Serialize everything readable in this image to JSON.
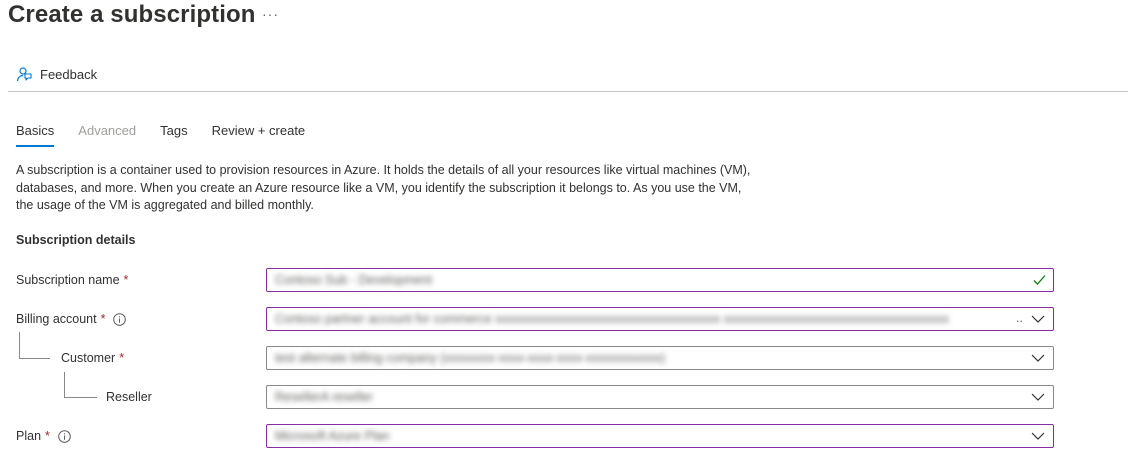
{
  "page": {
    "title": "Create a subscription",
    "more_label": "···"
  },
  "toolbar": {
    "feedback_label": "Feedback",
    "feedback_icon": "feedback-person-icon"
  },
  "tabs": [
    {
      "label": "Basics",
      "state": "active"
    },
    {
      "label": "Advanced",
      "state": "disabled"
    },
    {
      "label": "Tags",
      "state": "normal"
    },
    {
      "label": "Review + create",
      "state": "normal"
    }
  ],
  "description": "A subscription is a container used to provision resources in Azure. It holds the details of all your resources like virtual machines (VM), databases, and more. When you create an Azure resource like a VM, you identify the subscription it belongs to. As you use the VM, the usage of the VM is aggregated and billed monthly.",
  "section": {
    "title": "Subscription details"
  },
  "fields": {
    "subscription_name": {
      "label": "Subscription name",
      "required": "*",
      "value": "Contoso Sub - Development"
    },
    "billing_account": {
      "label": "Billing account",
      "required": "*",
      "value": "Contoso partner account for commerce xxxxxxxxxxxxxxxxxxxxxxxxxxxxxxxxxxxx xxxxxxxxxxxxxxxxxxxxxxxxxxxxxxxxxxxx",
      "ellipsis": ".."
    },
    "customer": {
      "label": "Customer",
      "required": "*",
      "value": "test alternate billing company (xxxxxxxx-xxxx-xxxx-xxxx-xxxxxxxxxxxx)"
    },
    "reseller": {
      "label": "Reseller",
      "value": "ResellerA reseller"
    },
    "plan": {
      "label": "Plan",
      "required": "*",
      "value": "Microsoft Azure Plan"
    }
  },
  "colors": {
    "accent": "#0078d4",
    "focus_border": "#8a2da5",
    "required": "#a4262c",
    "valid_check": "#107c10"
  }
}
